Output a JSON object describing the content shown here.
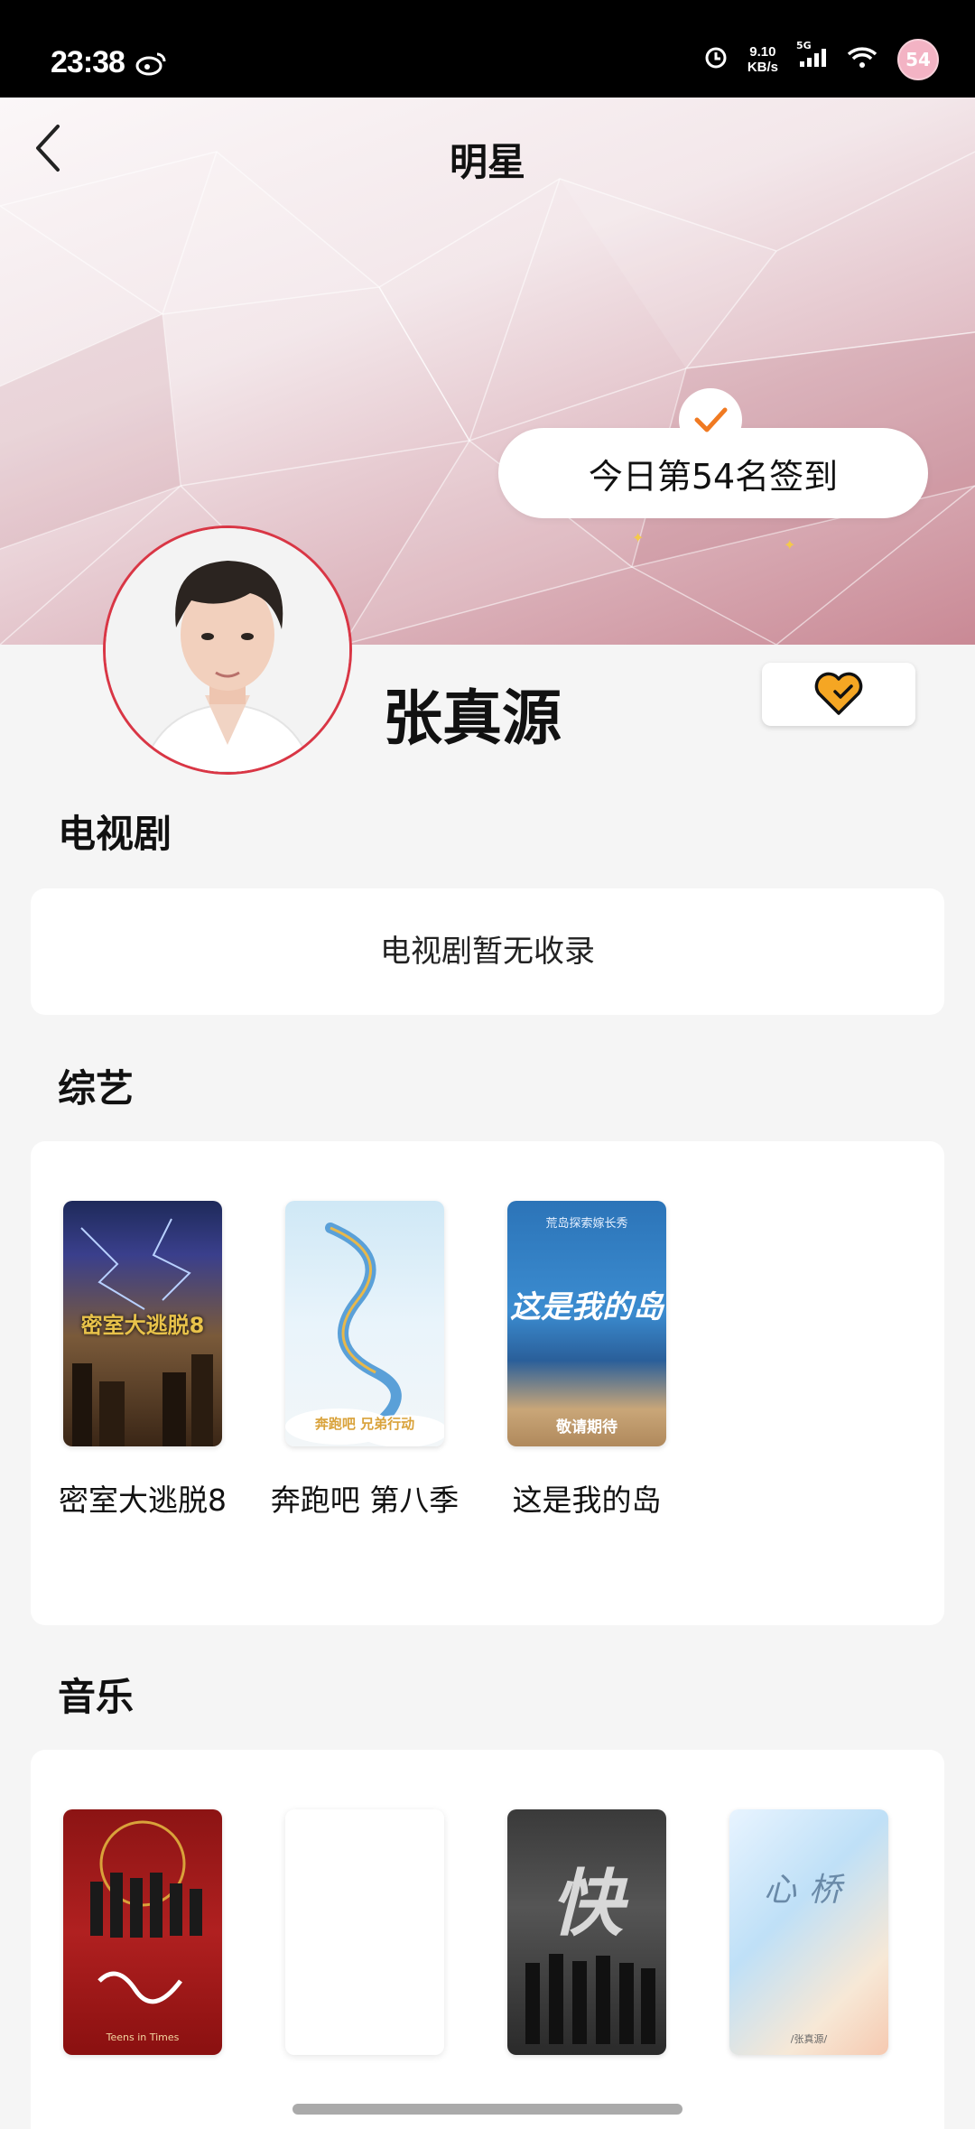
{
  "status_bar": {
    "time": "23:38",
    "net_speed_value": "9.10",
    "net_speed_unit": "KB/s",
    "network": "5G",
    "badge": "54"
  },
  "header": {
    "title": "明星",
    "back_icon": "chevron-left-icon"
  },
  "checkin": {
    "text": "今日第54名签到"
  },
  "profile": {
    "name": "张真源",
    "follow_icon": "heart-check-icon"
  },
  "sections": {
    "tv": {
      "title": "电视剧",
      "empty_text": "电视剧暂无收录"
    },
    "variety": {
      "title": "综艺",
      "items": [
        {
          "title": "密室大逃脱8",
          "poster_text": "密室大逃脱8"
        },
        {
          "title": "奔跑吧 第八季",
          "poster_text": "奔跑吧 兄弟行动"
        },
        {
          "title": "这是我的岛",
          "poster_text": "这是我的岛",
          "poster_sub": "敬请期待",
          "poster_top": "荒岛探索嫁长秀"
        }
      ]
    },
    "music": {
      "title": "音乐",
      "items": [
        {
          "poster_text": "Teens in Times"
        },
        {
          "poster_text": ""
        },
        {
          "poster_text": "快"
        },
        {
          "poster_text": "心桥",
          "poster_sub": "/张真源/"
        }
      ]
    }
  },
  "colors": {
    "accent_red": "#d93645",
    "heart_orange": "#f5a623",
    "check_orange": "#f07a22"
  }
}
